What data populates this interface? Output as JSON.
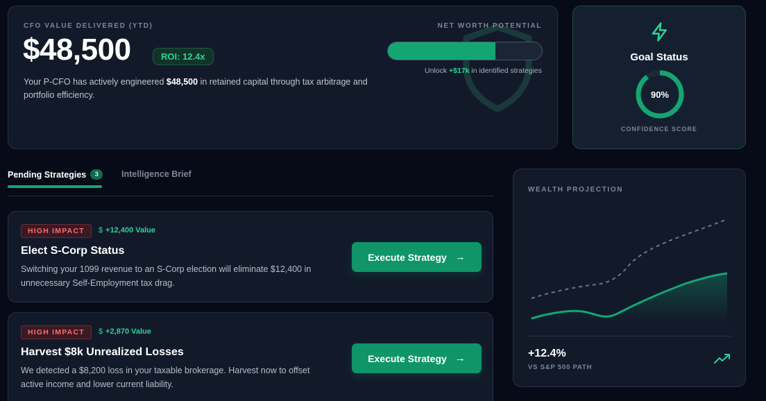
{
  "hero": {
    "eyebrow": "CFO VALUE DELIVERED (YTD)",
    "value": "$48,500",
    "roi_badge": "ROI: 12.4x",
    "desc_pre": "Your P-CFO has actively engineered ",
    "desc_bold": "$48,500",
    "desc_post": " in retained capital through tax arbitrage and portfolio efficiency.",
    "net_worth_label": "NET WORTH POTENTIAL",
    "net_worth_progress": 0.7,
    "unlock_pre": "Unlock ",
    "unlock_amount": "+$17k",
    "unlock_post": " in identified strategies"
  },
  "goal": {
    "title": "Goal Status",
    "percent_text": "90%",
    "percent": 0.9,
    "label": "CONFIDENCE SCORE",
    "icon": "lightning-icon"
  },
  "tabs": {
    "pending_label": "Pending Strategies",
    "pending_count": "3",
    "brief_label": "Intelligence Brief"
  },
  "strategies": [
    {
      "impact": "HIGH IMPACT",
      "value_symbol": "$",
      "value": "+12,400 Value",
      "title": "Elect S-Corp Status",
      "desc": "Switching your 1099 revenue to an S-Corp election will eliminate $12,400 in unnecessary Self-Employment tax drag.",
      "button": "Execute Strategy",
      "button_icon": "arrow-right-icon"
    },
    {
      "impact": "HIGH IMPACT",
      "value_symbol": "$",
      "value": "+2,870 Value",
      "title": "Harvest $8k Unrealized Losses",
      "desc": "We detected a $8,200 loss in your taxable brokerage. Harvest now to offset active income and lower current liability.",
      "button": "Execute Strategy",
      "button_icon": "arrow-right-icon"
    }
  ],
  "wealth": {
    "label": "WEALTH PROJECTION",
    "value": "+12.4%",
    "sub": "VS S&P 500 PATH",
    "icon": "trending-up-icon"
  },
  "colors": {
    "accent": "#14a672",
    "accent_text": "#2fd295",
    "danger": "#ff6b74",
    "background": "#060b17",
    "card": "#121a2a"
  }
}
